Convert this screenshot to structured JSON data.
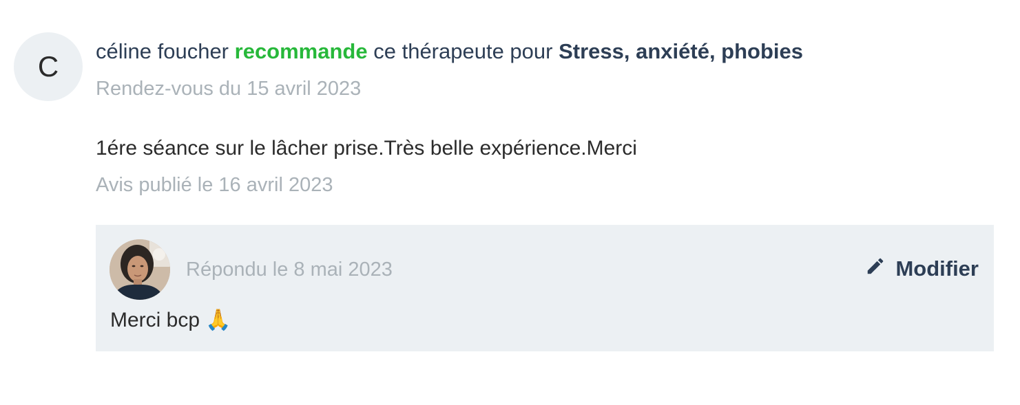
{
  "reviewer": {
    "initial": "C",
    "name": "céline foucher",
    "action": "recommande",
    "middle": "ce thérapeute pour",
    "specialty": "Stress, anxiété, phobies",
    "appointment": "Rendez-vous du 15 avril 2023"
  },
  "review": {
    "text": "1ére séance sur le lâcher prise.Très belle expérience.Merci",
    "published": "Avis publié le 16 avril 2023"
  },
  "reply": {
    "date": "Répondu le 8 mai 2023",
    "edit_label": "Modifier",
    "text": "Merci bcp 🙏"
  },
  "colors": {
    "recommend_green": "#27b83a",
    "navy": "#2d3e55",
    "muted_gray": "#aab2b8",
    "reply_background": "#ecf0f3"
  }
}
